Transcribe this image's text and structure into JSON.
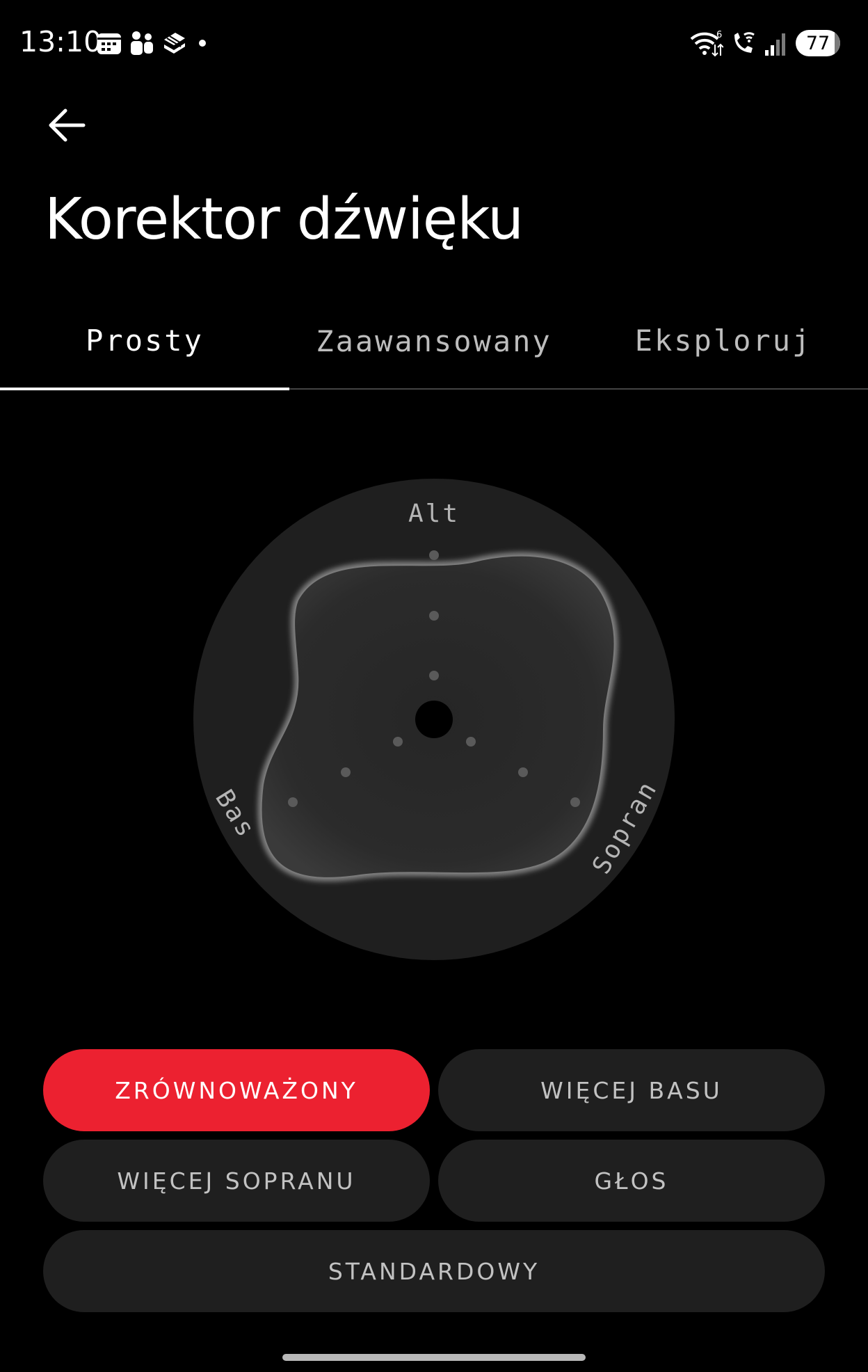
{
  "status_bar": {
    "time": "13:10",
    "battery": "77",
    "left_icons": [
      "calendar-icon",
      "teams-icon",
      "layers-icon",
      "dot-icon"
    ],
    "right_icons": [
      "wifi-6-icon",
      "wifi-calling-icon",
      "signal-icon"
    ]
  },
  "header": {
    "back_icon": "arrow-left-icon",
    "title": "Korektor dźwięku"
  },
  "tabs": [
    {
      "label": "Prosty",
      "active": true
    },
    {
      "label": "Zaawansowany",
      "active": false
    },
    {
      "label": "Eksploruj",
      "active": false
    }
  ],
  "eq": {
    "labels": {
      "alt": "Alt",
      "bas": "Bas",
      "sopran": "Sopran"
    },
    "colors": {
      "dial": "#1f1f1f",
      "shape": "#2a2a2a",
      "shape_edge": "#8c8c8c",
      "dots": "#5a5a5a",
      "center": "#000000"
    }
  },
  "presets": [
    {
      "label": "ZRÓWNOWAŻONY",
      "selected": true
    },
    {
      "label": "WIĘCEJ BASU",
      "selected": false
    },
    {
      "label": "WIĘCEJ SOPRANU",
      "selected": false
    },
    {
      "label": "GŁOS",
      "selected": false
    },
    {
      "label": "STANDARDOWY",
      "selected": false
    }
  ],
  "colors": {
    "accent": "#ec2130",
    "background": "#000000",
    "button": "#1f1f1f"
  }
}
